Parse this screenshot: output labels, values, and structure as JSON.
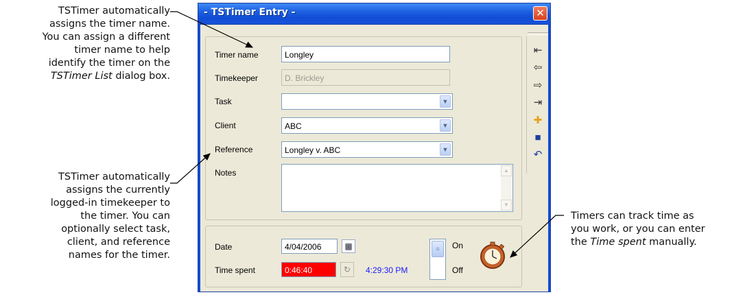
{
  "callouts": {
    "top_left": [
      "TSTimer automatically",
      "assigns the timer name.",
      "You can assign a different",
      "timer name to help",
      "identify the timer on the"
    ],
    "top_left_last": {
      "italic": "TSTimer List",
      "rest": " dialog box."
    },
    "bottom_left": [
      "TSTimer automatically",
      "assigns the currently",
      "logged-in timekeeper to",
      "the timer. You can",
      "optionally select task,",
      "client, and reference",
      "names for the timer."
    ],
    "right": [
      "Timers can track time as",
      "you work, or you can enter"
    ],
    "right_last": {
      "prefix": "the ",
      "italic": "Time spent",
      "rest": " manually."
    }
  },
  "window": {
    "title": "- TSTimer Entry -",
    "close_symbol": "✕"
  },
  "form": {
    "timer_name": {
      "label": "Timer name",
      "value": "Longley"
    },
    "timekeeper": {
      "label": "Timekeeper",
      "value": "D. Brickley"
    },
    "task": {
      "label": "Task",
      "value": ""
    },
    "client": {
      "label": "Client",
      "value": "ABC"
    },
    "reference": {
      "label": "Reference",
      "value": "Longley v. ABC"
    },
    "notes": {
      "label": "Notes",
      "value": ""
    },
    "combo_arrow": "▼"
  },
  "timing": {
    "date": {
      "label": "Date",
      "value": "4/04/2006"
    },
    "time_spent": {
      "label": "Time spent",
      "value": "0:46:40",
      "color": "#ff0000"
    },
    "clock": {
      "value": "4:29:30 PM",
      "color": "#1a1aff"
    },
    "toggle_on": "On",
    "toggle_off": "Off"
  },
  "toolbar": [
    {
      "name": "first-record-icon",
      "glyph": "⇤"
    },
    {
      "name": "previous-record-icon",
      "glyph": "⇦"
    },
    {
      "name": "next-record-icon",
      "glyph": "⇨"
    },
    {
      "name": "last-record-icon",
      "glyph": "⇥"
    },
    {
      "name": "add-record-icon",
      "glyph": "✚",
      "color": "#e8a020"
    },
    {
      "name": "save-icon",
      "glyph": "■",
      "color": "#1c3f9c"
    },
    {
      "name": "undo-icon",
      "glyph": "↶",
      "color": "#1c3f9c"
    }
  ],
  "colors": {
    "title_bar": "#0f4dd6",
    "window_bg": "#ece9d8",
    "close_button": "#d8421e"
  }
}
